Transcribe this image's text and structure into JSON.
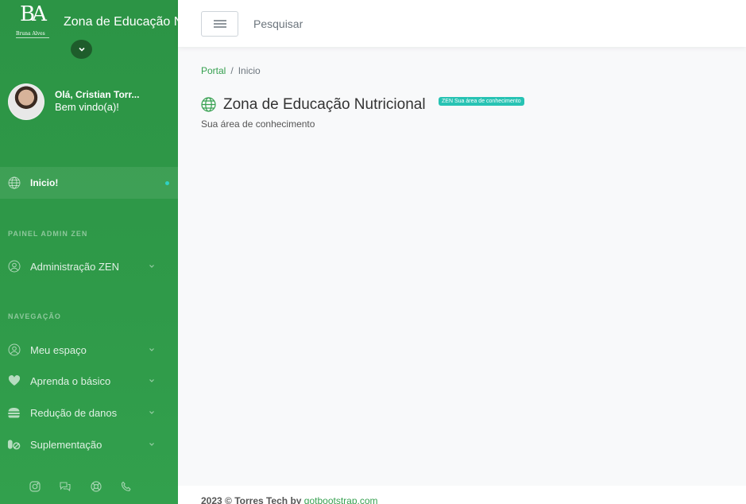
{
  "brand": {
    "title": "Zona de Educação Nutricional",
    "logo_mono": "BA",
    "logo_sub": "Bruna Alves"
  },
  "user": {
    "greeting": "Olá, Cristian Torr...",
    "welcome": "Bem vindo(a)!"
  },
  "nav": {
    "home": "Inicio!",
    "section_admin": "PAINEL ADMIN ZEN",
    "admin_item": "Administração ZEN",
    "section_nav": "NAVEGAÇÃO",
    "items": [
      {
        "label": "Meu espaço",
        "icon": "user-circle-icon"
      },
      {
        "label": "Aprenda o básico",
        "icon": "heart-icon"
      },
      {
        "label": "Redução de danos",
        "icon": "burger-icon"
      },
      {
        "label": "Suplementação",
        "icon": "pills-icon"
      }
    ]
  },
  "social_icons": [
    "instagram-icon",
    "chat-icon",
    "lifebuoy-icon",
    "phone-icon"
  ],
  "topbar": {
    "search": "Pesquisar"
  },
  "breadcrumb": {
    "root": "Portal",
    "current": "Inicio"
  },
  "page": {
    "title": "Zona de Educação Nutricional",
    "badge": "ZEN Sua área de conhecimento",
    "subtitle": "Sua área de conhecimento"
  },
  "footer": {
    "text": "2023 © Torres Tech by ",
    "link": "gotbootstrap.com"
  },
  "colors": {
    "sidebar": "#2f9a49",
    "accent": "#35a04f",
    "badge": "#27c3b3"
  }
}
